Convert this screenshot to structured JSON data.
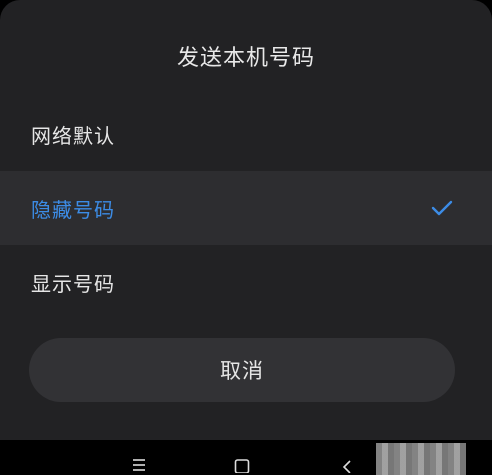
{
  "dialog": {
    "title": "发送本机号码",
    "options": [
      {
        "label": "网络默认",
        "selected": false
      },
      {
        "label": "隐藏号码",
        "selected": true
      },
      {
        "label": "显示号码",
        "selected": false
      }
    ],
    "cancel_label": "取消"
  },
  "colors": {
    "sheet_background": "#222224",
    "selected_row_background": "#2d2d30",
    "accent": "#3c8ce6",
    "text": "#e6e6e6",
    "cancel_button_background": "#323235"
  },
  "icons": {
    "selected_indicator": "check-icon",
    "nav_menu": "menu-icon",
    "nav_home": "home-square-icon",
    "nav_back": "back-chevron-icon"
  }
}
